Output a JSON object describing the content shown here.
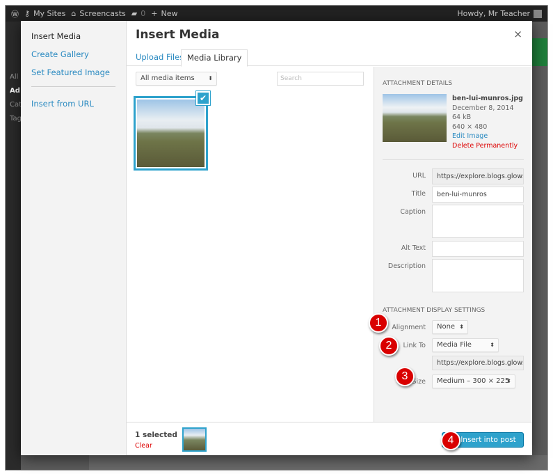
{
  "adminbar": {
    "my_sites": "My Sites",
    "site": "Screencasts",
    "comments": "0",
    "new": "New",
    "howdy": "Howdy, Mr Teacher"
  },
  "admin_menu_fragments": [
    "All",
    "Ad",
    "Cat",
    "Tag"
  ],
  "modal": {
    "title": "Insert Media",
    "close": "×",
    "menu": [
      {
        "label": "Insert Media"
      },
      {
        "label": "Create Gallery"
      },
      {
        "label": "Set Featured Image"
      },
      {
        "label": "Insert from URL"
      }
    ],
    "tabs": [
      {
        "label": "Upload Files"
      },
      {
        "label": "Media Library"
      }
    ],
    "filter": "All media items",
    "search_placeholder": "Search",
    "details": {
      "heading": "ATTACHMENT DETAILS",
      "filename": "ben-lui-munros.jpg",
      "date": "December 8, 2014",
      "size": "64 kB",
      "dimensions": "640 × 480",
      "edit": "Edit Image",
      "delete": "Delete Permanently",
      "fields": {
        "url_label": "URL",
        "url": "https://explore.blogs.glowsc",
        "title_label": "Title",
        "title": "ben-lui-munros",
        "caption_label": "Caption",
        "alt_label": "Alt Text",
        "description_label": "Description"
      }
    },
    "display": {
      "heading": "ATTACHMENT DISPLAY SETTINGS",
      "alignment_label": "Alignment",
      "alignment": "None",
      "link_label": "Link To",
      "link": "Media File",
      "link_url": "https://explore.blogs.glowsc",
      "size_label": "Size",
      "size": "Medium – 300 × 225"
    },
    "footer": {
      "selected": "1 selected",
      "clear": "Clear",
      "insert": "Insert into post"
    }
  },
  "callouts": [
    "1",
    "2",
    "3",
    "4"
  ],
  "colors": {
    "accent": "#2ea2cc",
    "callout": "#d90000",
    "delete": "#dd0000"
  }
}
